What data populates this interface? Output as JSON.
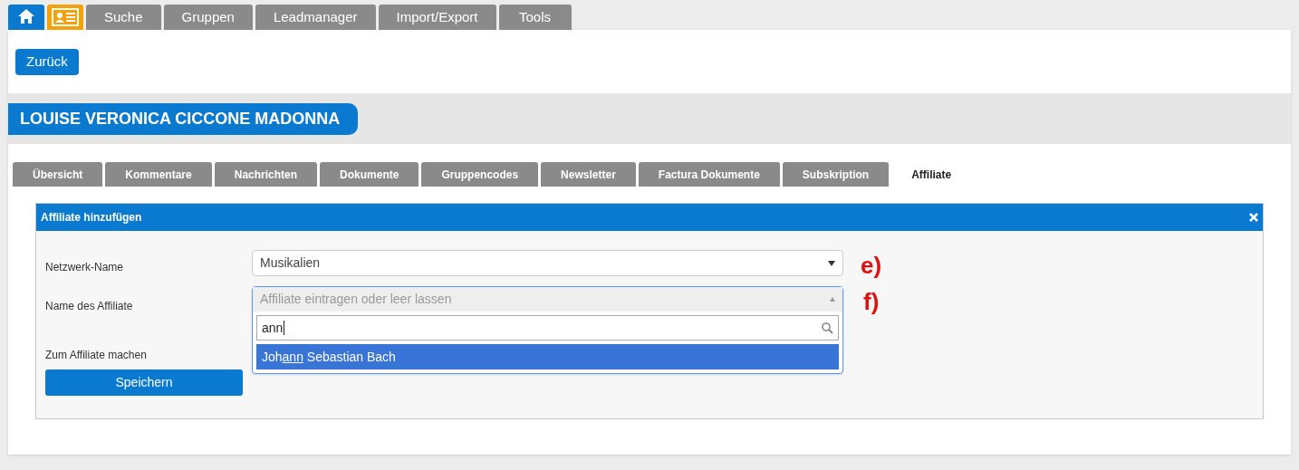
{
  "nav_tabs": [
    {
      "kind": "home",
      "selected": true
    },
    {
      "kind": "contact-card",
      "selected": false
    },
    {
      "kind": "text",
      "label": "Suche",
      "selected": false
    },
    {
      "kind": "text",
      "label": "Gruppen",
      "selected": false
    },
    {
      "kind": "text",
      "label": "Leadmanager",
      "selected": false
    },
    {
      "kind": "text",
      "label": "Import/Export",
      "selected": false
    },
    {
      "kind": "text",
      "label": "Tools",
      "selected": false
    }
  ],
  "back_button": "Zurück",
  "contact_name": "LOUISE VERONICA CICCONE MADONNA",
  "detail_tabs": [
    {
      "label": "Übersicht",
      "selected": false
    },
    {
      "label": "Kommentare",
      "selected": false
    },
    {
      "label": "Nachrichten",
      "selected": false
    },
    {
      "label": "Dokumente",
      "selected": false
    },
    {
      "label": "Gruppencodes",
      "selected": false
    },
    {
      "label": "Newsletter",
      "selected": false
    },
    {
      "label": "Factura Dokumente",
      "selected": false
    },
    {
      "label": "Subskription",
      "selected": false
    },
    {
      "label": "Affiliate",
      "selected": true
    }
  ],
  "panel": {
    "title": "Affiliate hinzufügen",
    "network_label": "Netzwerk-Name",
    "network_value": "Musikalien",
    "affiliate_label": "Name des Affiliate",
    "affiliate_placeholder": "Affiliate eintragen oder leer lassen",
    "search_value": "ann",
    "result": {
      "before": "Joh",
      "match": "ann",
      "after": " Sebastian Bach"
    },
    "make_affiliate_label": "Zum Affiliate machen",
    "save_button": "Speichern"
  },
  "annotations": [
    "e)",
    "f)"
  ]
}
